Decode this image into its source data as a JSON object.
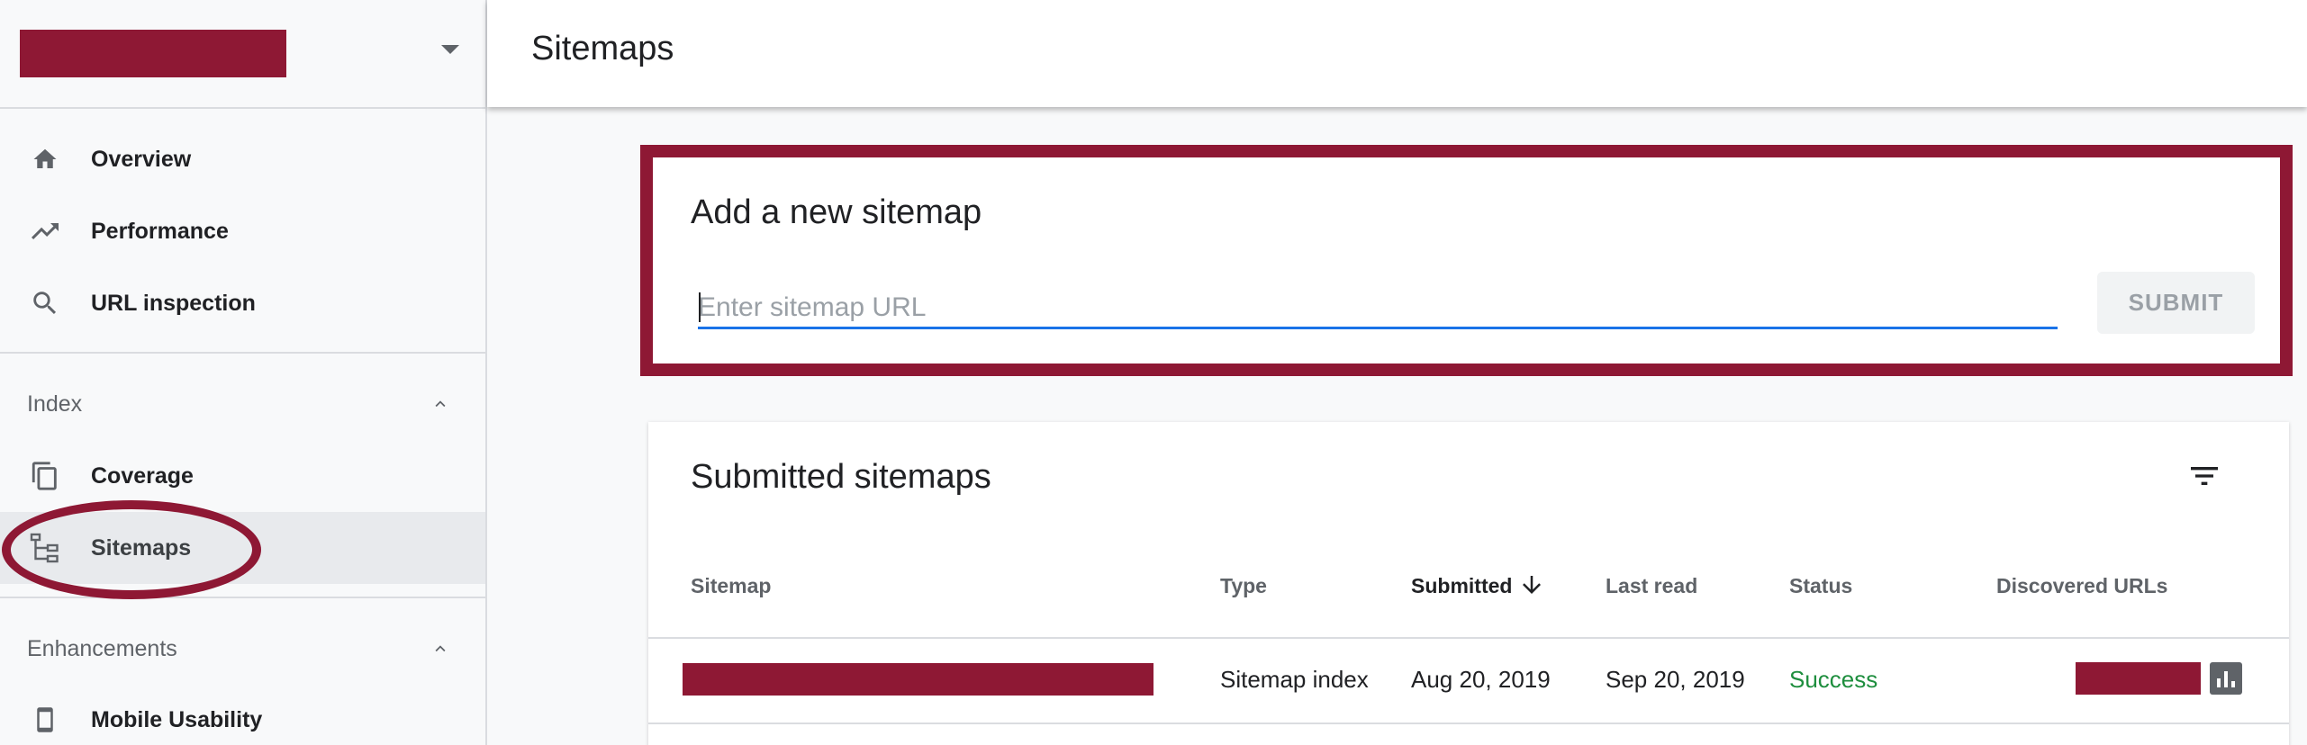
{
  "sidebar": {
    "nav_top": [
      {
        "label": "Overview",
        "icon": "home-icon"
      },
      {
        "label": "Performance",
        "icon": "trending-up-icon"
      },
      {
        "label": "URL inspection",
        "icon": "search-icon"
      }
    ],
    "index_section": {
      "label": "Index",
      "items": [
        {
          "label": "Coverage",
          "icon": "copy-pages-icon"
        },
        {
          "label": "Sitemaps",
          "icon": "sitemap-tree-icon",
          "active": true
        }
      ]
    },
    "enhancements_section": {
      "label": "Enhancements",
      "items": [
        {
          "label": "Mobile Usability",
          "icon": "smartphone-icon"
        }
      ]
    }
  },
  "header": {
    "title": "Sitemaps"
  },
  "add_sitemap": {
    "title": "Add a new sitemap",
    "placeholder": "Enter sitemap URL",
    "value": "",
    "submit_label": "SUBMIT"
  },
  "submitted": {
    "title": "Submitted sitemaps",
    "columns": {
      "sitemap": "Sitemap",
      "type": "Type",
      "submitted": "Submitted",
      "last_read": "Last read",
      "status": "Status",
      "discovered": "Discovered URLs"
    },
    "rows": [
      {
        "type": "Sitemap index",
        "submitted": "Aug 20, 2019",
        "last_read": "Sep 20, 2019",
        "status": "Success"
      }
    ]
  },
  "colors": {
    "redaction": "#8e1834",
    "accent_blue": "#1a73e8",
    "success_green": "#1e8e3e"
  }
}
